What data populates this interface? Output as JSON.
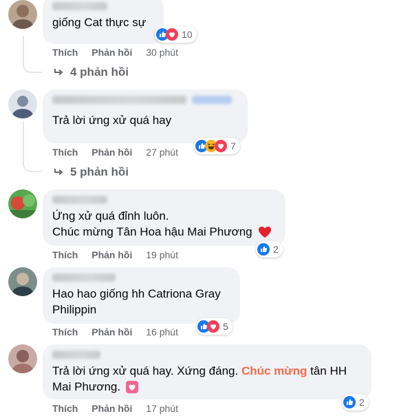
{
  "comments": [
    {
      "text_lines": [
        "giống Cat thực sự"
      ],
      "actions": {
        "like": "Thích",
        "reply": "Phản hồi",
        "time": "30 phút"
      },
      "reaction_icons": [
        "like-icon",
        "love-icon"
      ],
      "reaction_count": "10",
      "replies": "4 phản hồi"
    },
    {
      "text_lines": [
        "Trả lời ứng xử quá hay"
      ],
      "actions": {
        "like": "Thích",
        "reply": "Phản hồi",
        "time": "27 phút"
      },
      "reaction_icons": [
        "like-icon",
        "haha-icon",
        "love-icon"
      ],
      "reaction_count": "7",
      "replies": "5 phản hồi"
    },
    {
      "text_lines": [
        "Ứng xử quá đỉnh luôn.",
        "Chúc mừng Tân Hoa hậu Mai Phương"
      ],
      "actions": {
        "like": "Thích",
        "reply": "Phản hồi",
        "time": "19 phút"
      },
      "reaction_icons": [
        "like-icon"
      ],
      "reaction_count": "2"
    },
    {
      "text_lines": [
        "Hao hao giống hh Catriona Gray",
        "Philippin"
      ],
      "actions": {
        "like": "Thích",
        "reply": "Phản hồi",
        "time": "16 phút"
      },
      "reaction_icons": [
        "like-icon",
        "love-icon"
      ],
      "reaction_count": "5"
    },
    {
      "text_part1": "Trả lời ứng xử quá hay. Xứng đáng. ",
      "text_highlight": "Chúc mừng",
      "text_part2": " tân HH",
      "text_line2": "Mai Phương.",
      "actions": {
        "like": "Thích",
        "reply": "Phản hồi",
        "time": "17 phút"
      },
      "reaction_icons": [
        "like-icon"
      ],
      "reaction_count": "2"
    }
  ],
  "colors": {
    "bubble": "#f0f2f5",
    "meta": "#65676b",
    "text": "#050505",
    "like": "#1877f2",
    "love": "#f33e58",
    "haha": "#f7b125",
    "highlight": "#f26b4a"
  }
}
